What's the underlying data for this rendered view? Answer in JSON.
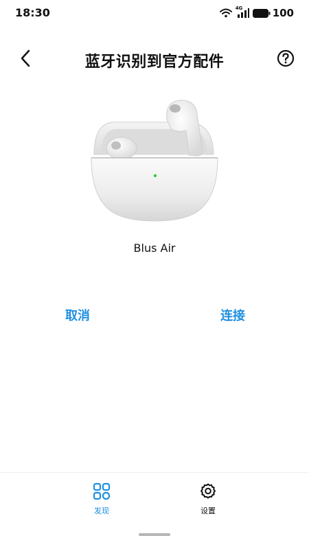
{
  "status_bar": {
    "time": "18:30",
    "network_label": "4G",
    "battery": "100"
  },
  "header": {
    "title": "蓝牙识别到官方配件",
    "back_icon": "chevron-left-icon",
    "help_icon": "question-circle-icon"
  },
  "device": {
    "name": "Blus Air"
  },
  "actions": {
    "cancel_label": "取消",
    "connect_label": "连接"
  },
  "bottom_nav": {
    "items": [
      {
        "label": "发现",
        "icon": "grid-icon",
        "active": true
      },
      {
        "label": "设置",
        "icon": "gear-icon",
        "active": false
      }
    ]
  },
  "colors": {
    "accent": "#1e8fe0",
    "text": "#111111",
    "background": "#ffffff",
    "indicator_led": "#2ecc40"
  }
}
